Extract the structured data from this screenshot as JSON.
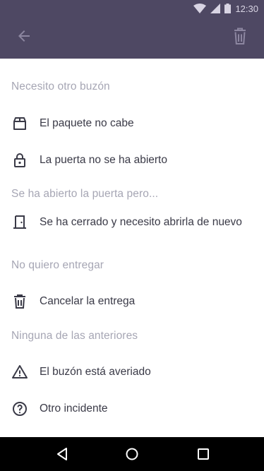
{
  "status_bar": {
    "time": "12:30"
  },
  "app_bar": {
    "back_icon": "arrow-back-icon",
    "delete_icon": "trash-icon"
  },
  "sections": [
    {
      "header": "Necesito otro buzón",
      "options": [
        {
          "label": "El paquete no cabe",
          "icon": "box-icon"
        },
        {
          "label": "La puerta no se ha abierto",
          "icon": "lock-icon"
        }
      ]
    },
    {
      "header": "Se ha abierto la puerta pero...",
      "options": [
        {
          "label": "Se ha cerrado y necesito abrirla de nuevo",
          "icon": "door-icon"
        }
      ]
    },
    {
      "header": "No quiero entregar",
      "options": [
        {
          "label": "Cancelar la entrega",
          "icon": "trash-icon"
        }
      ]
    },
    {
      "header": "Ninguna de las anteriores",
      "options": [
        {
          "label": "El buzón está averiado",
          "icon": "warning-icon"
        },
        {
          "label": "Otro incidente",
          "icon": "help-icon"
        }
      ]
    }
  ],
  "colors": {
    "app_bar": "#4e4863",
    "section_header": "#a6a6b4",
    "option_text": "#3a3a47",
    "nav_bar": "#000000"
  }
}
